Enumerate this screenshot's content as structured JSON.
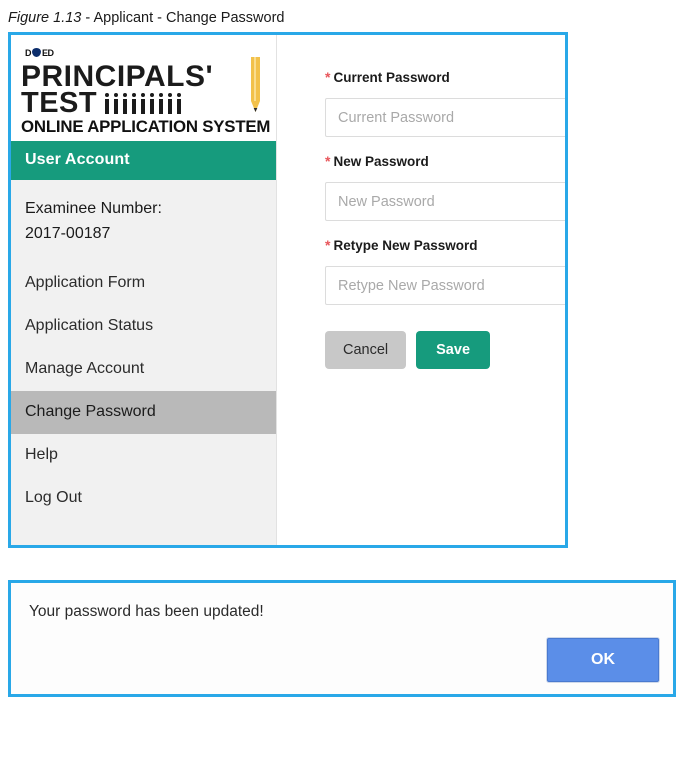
{
  "caption": {
    "figure_number": "Figure 1.13",
    "separator": " - ",
    "title": "Applicant - Change Password"
  },
  "colors": {
    "panel_border": "#29a8e8",
    "brand_teal": "#169b7d",
    "active_nav": "#b9b9b9",
    "required_star": "#e8565b",
    "ok_button": "#5b8ee8",
    "sidebar_bg": "#f1f1f1",
    "cancel_button": "#c8c8c8",
    "pencil_yellow": "#f2c14b"
  },
  "sidebar": {
    "logo": {
      "deped_mark": "DepED",
      "line1": "PRINCIPALS'",
      "line2": "TEST",
      "line3": "ONLINE APPLICATION SYSTEM",
      "people_count": 9,
      "pencil_icon": "pencil-icon"
    },
    "header": "User Account",
    "examinee_label": "Examinee Number:",
    "examinee_number": "2017-00187",
    "items": [
      {
        "label": "Application Form",
        "active": false
      },
      {
        "label": "Application Status",
        "active": false
      },
      {
        "label": "Manage Account",
        "active": false
      },
      {
        "label": "Change Password",
        "active": true
      },
      {
        "label": "Help",
        "active": false
      },
      {
        "label": "Log Out",
        "active": false
      }
    ]
  },
  "form": {
    "required_marker": "*",
    "fields": [
      {
        "label": "Current Password",
        "placeholder": "Current Password",
        "value": "",
        "required": true
      },
      {
        "label": "New Password",
        "placeholder": "New Password",
        "value": "",
        "required": true
      },
      {
        "label": "Retype New Password",
        "placeholder": "Retype New Password",
        "value": "",
        "required": true
      }
    ],
    "cancel_label": "Cancel",
    "save_label": "Save"
  },
  "dialog": {
    "message": "Your password has been updated!",
    "ok_label": "OK"
  }
}
